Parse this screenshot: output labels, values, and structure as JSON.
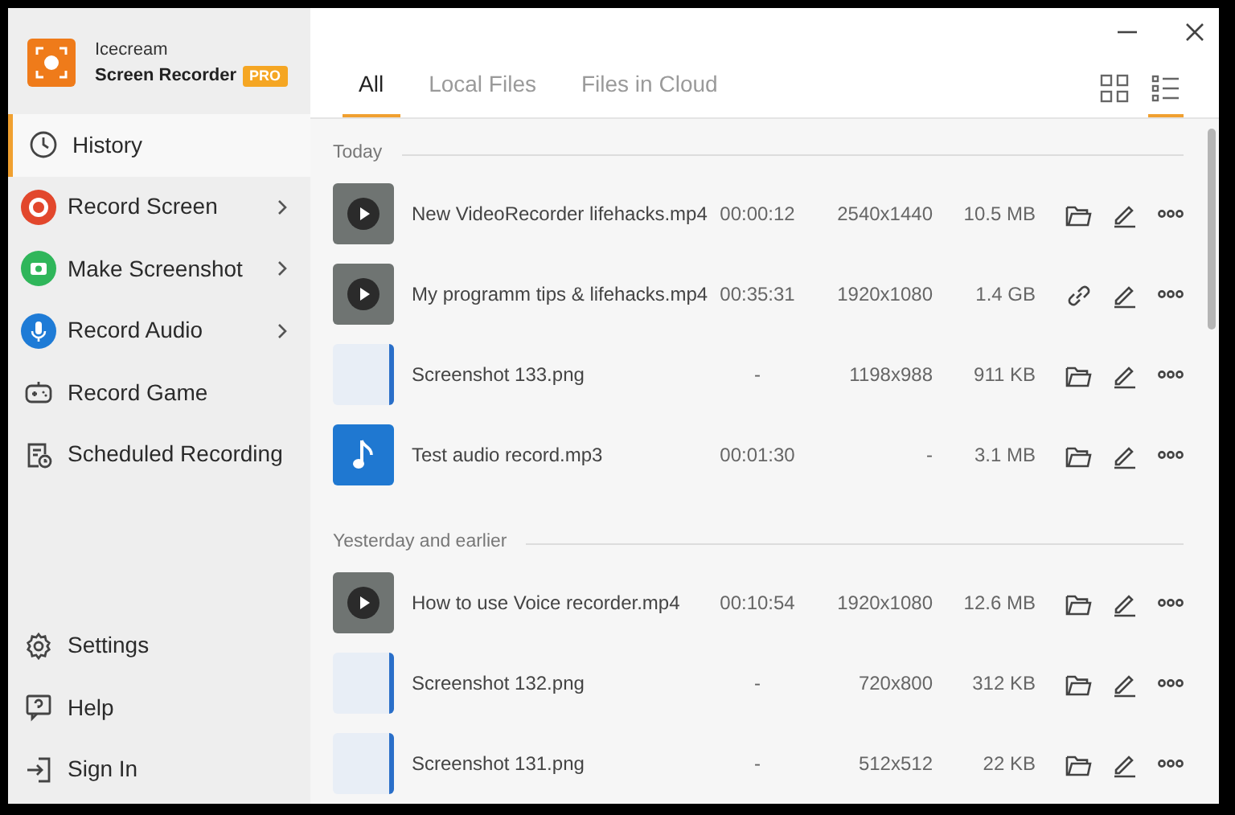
{
  "app": {
    "name_line1": "Icecream",
    "name_line2": "Screen Recorder",
    "badge": "PRO"
  },
  "sidebar": {
    "items": [
      {
        "label": "History",
        "kind": "clock",
        "selected": true,
        "has_submenu": false
      },
      {
        "label": "Record Screen",
        "kind": "record",
        "selected": false,
        "has_submenu": true
      },
      {
        "label": "Make Screenshot",
        "kind": "camera",
        "selected": false,
        "has_submenu": true
      },
      {
        "label": "Record Audio",
        "kind": "mic",
        "selected": false,
        "has_submenu": true
      },
      {
        "label": "Record Game",
        "kind": "gamepad",
        "selected": false,
        "has_submenu": false
      },
      {
        "label": "Scheduled Recording",
        "kind": "schedule",
        "selected": false,
        "has_submenu": false
      }
    ],
    "bottom_items": [
      {
        "label": "Settings",
        "kind": "gear"
      },
      {
        "label": "Help",
        "kind": "help"
      },
      {
        "label": "Sign In",
        "kind": "signin"
      }
    ]
  },
  "tabs": [
    {
      "label": "All",
      "selected": true
    },
    {
      "label": "Local Files",
      "selected": false
    },
    {
      "label": "Files in Cloud",
      "selected": false
    }
  ],
  "view_modes": [
    {
      "kind": "grid",
      "selected": false
    },
    {
      "kind": "list",
      "selected": true
    }
  ],
  "groups": [
    {
      "title": "Today",
      "rows": [
        {
          "thumb": {
            "kind": "video"
          },
          "name": "New VideoRecorder lifehacks.mp4",
          "duration": "00:00:12",
          "resolution": "2540x1440",
          "size": "10.5 MB",
          "action": {
            "kind": "folder"
          }
        },
        {
          "thumb": {
            "kind": "video"
          },
          "name": "My programm tips & lifehacks.mp4",
          "duration": "00:35:31",
          "resolution": "1920x1080",
          "size": "1.4 GB",
          "action": {
            "kind": "link"
          }
        },
        {
          "thumb": {
            "kind": "image"
          },
          "name": "Screenshot 133.png",
          "duration": "-",
          "resolution": "1198x988",
          "size": "911 KB",
          "action": {
            "kind": "folder"
          }
        },
        {
          "thumb": {
            "kind": "audio"
          },
          "name": "Test audio record.mp3",
          "duration": "00:01:30",
          "resolution": "-",
          "size": "3.1 MB",
          "action": {
            "kind": "folder"
          }
        }
      ]
    },
    {
      "title": "Yesterday and earlier",
      "rows": [
        {
          "thumb": {
            "kind": "video"
          },
          "name": "How to use Voice recorder.mp4",
          "duration": "00:10:54",
          "resolution": "1920x1080",
          "size": "12.6 MB",
          "action": {
            "kind": "folder"
          }
        },
        {
          "thumb": {
            "kind": "image"
          },
          "name": "Screenshot 132.png",
          "duration": "-",
          "resolution": "720x800",
          "size": "312 KB",
          "action": {
            "kind": "folder"
          }
        },
        {
          "thumb": {
            "kind": "image"
          },
          "name": "Screenshot 131.png",
          "duration": "-",
          "resolution": "512x512",
          "size": "22 KB",
          "action": {
            "kind": "folder"
          }
        }
      ]
    }
  ]
}
